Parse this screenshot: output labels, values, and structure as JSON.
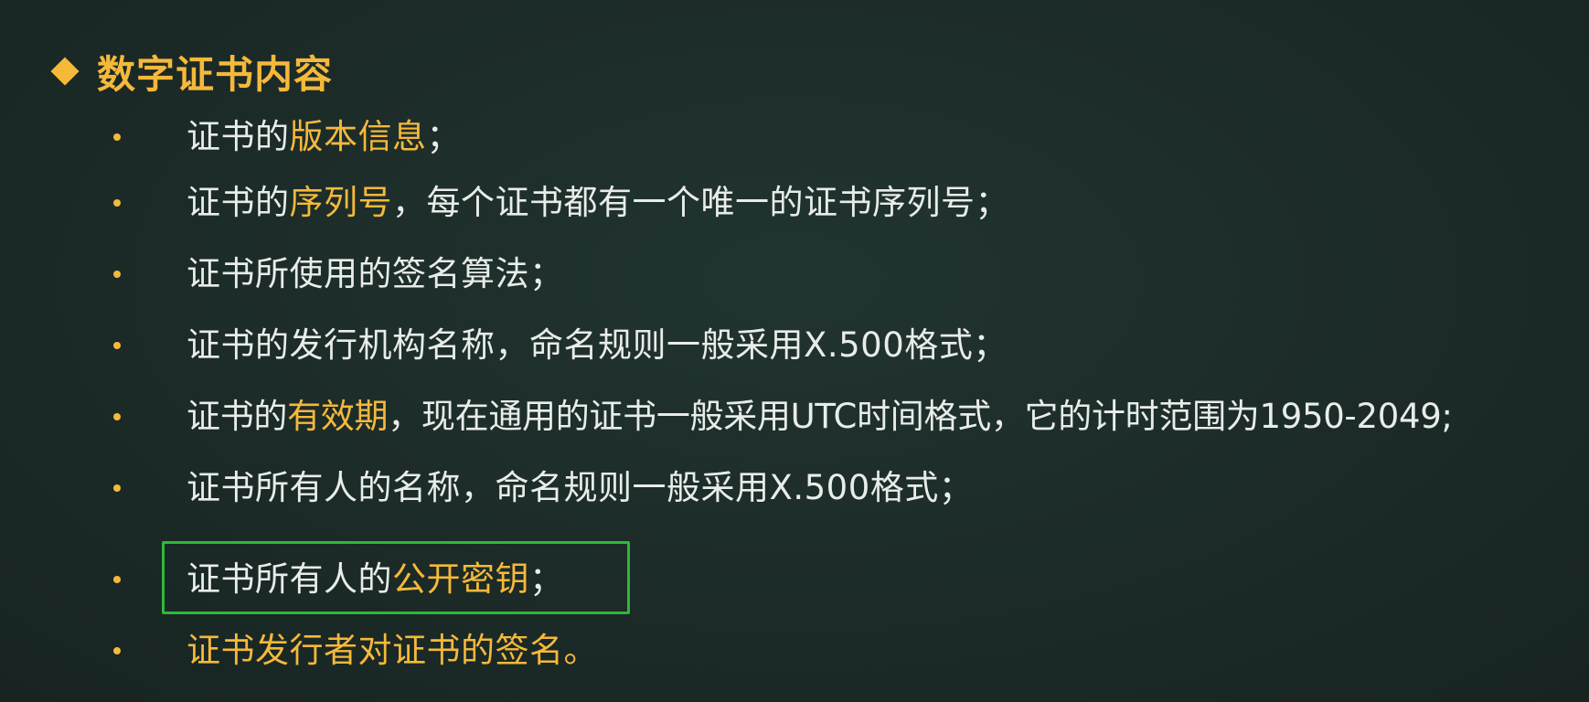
{
  "heading": {
    "icon": "diamond-icon",
    "title": "数字证书内容",
    "accent_color": "#f5b93a"
  },
  "items": [
    {
      "pre": "证书的",
      "hl": "版本信息",
      "post": "；"
    },
    {
      "pre": "证书的",
      "hl": "序列号",
      "post": "，每个证书都有一个唯一的证书序列号；"
    },
    {
      "pre": "证书所使用的签名算法；",
      "hl": "",
      "post": ""
    },
    {
      "pre": "证书的发行机构名称，命名规则一般采用X.500格式；",
      "hl": "",
      "post": ""
    },
    {
      "pre": "证书的",
      "hl": "有效期",
      "post": "，现在通用的证书一般采用UTC时间格式，它的计时范围为1950-2049;"
    },
    {
      "pre": "证书所有人的名称，命名规则一般采用X.500格式；",
      "hl": "",
      "post": ""
    },
    {
      "pre": "证书所有人的",
      "hl": "公开密钥",
      "post": "；"
    },
    {
      "pre": "",
      "hl": "证书发行者对证书的签名。",
      "post": ""
    }
  ],
  "colors": {
    "background": "#1b2a27",
    "text": "#e8ecea",
    "highlight": "#f5b93a",
    "box_outline": "#2fb838"
  }
}
